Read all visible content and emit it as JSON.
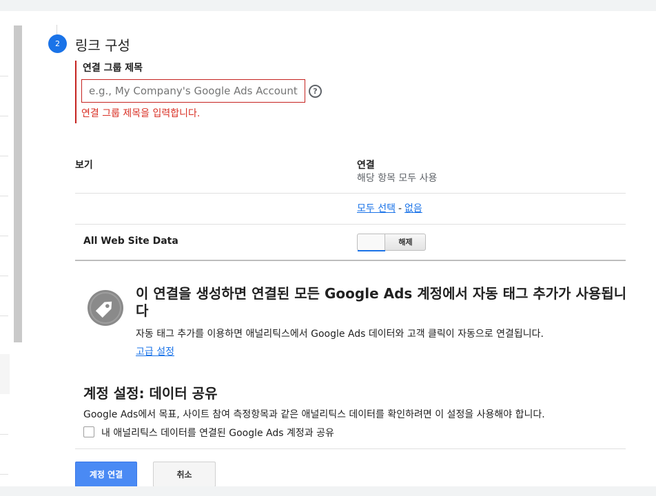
{
  "step": {
    "number": "2",
    "title": "링크 구성"
  },
  "link_group": {
    "label": "연결 그룹 제목",
    "placeholder": "e.g., My Company's Google Ads Account",
    "value": "",
    "help_icon": "?",
    "error": "연결 그룹 제목을 입력합니다."
  },
  "views_table": {
    "col_view": "보기",
    "col_link": "연결",
    "col_link_sub": "해당 항목 모두 사용",
    "select_all": "모두 선택",
    "separator": "-",
    "select_none": "없음",
    "rows": [
      {
        "name": "All Web Site Data",
        "toggle_label": "해제",
        "state": "off"
      }
    ]
  },
  "auto_tagging": {
    "icon": "tag-icon",
    "title": "이 연결을 생성하면 연결된 모든 Google Ads 계정에서 자동 태그 추가가 사용됩니다",
    "description": "자동 태그 추가를 이용하면 애널리틱스에서 Google Ads 데이터와 고객 클릭이 자동으로 연결됩니다.",
    "advanced_link": "고급 설정"
  },
  "data_sharing": {
    "title": "계정 설정: 데이터 공유",
    "description": "Google Ads에서 목표, 사이트 참여 측정항목과 같은 애널리틱스 데이터를 확인하려면 이 설정을 사용해야 합니다.",
    "checkbox_label": "내 애널리틱스 데이터를 연결된 Google Ads 계정과 공유",
    "checked": false
  },
  "actions": {
    "connect": "계정 연결",
    "cancel": "취소"
  },
  "colors": {
    "accent": "#1a73e8",
    "error": "#d93025",
    "primary_button": "#4a8af4"
  }
}
